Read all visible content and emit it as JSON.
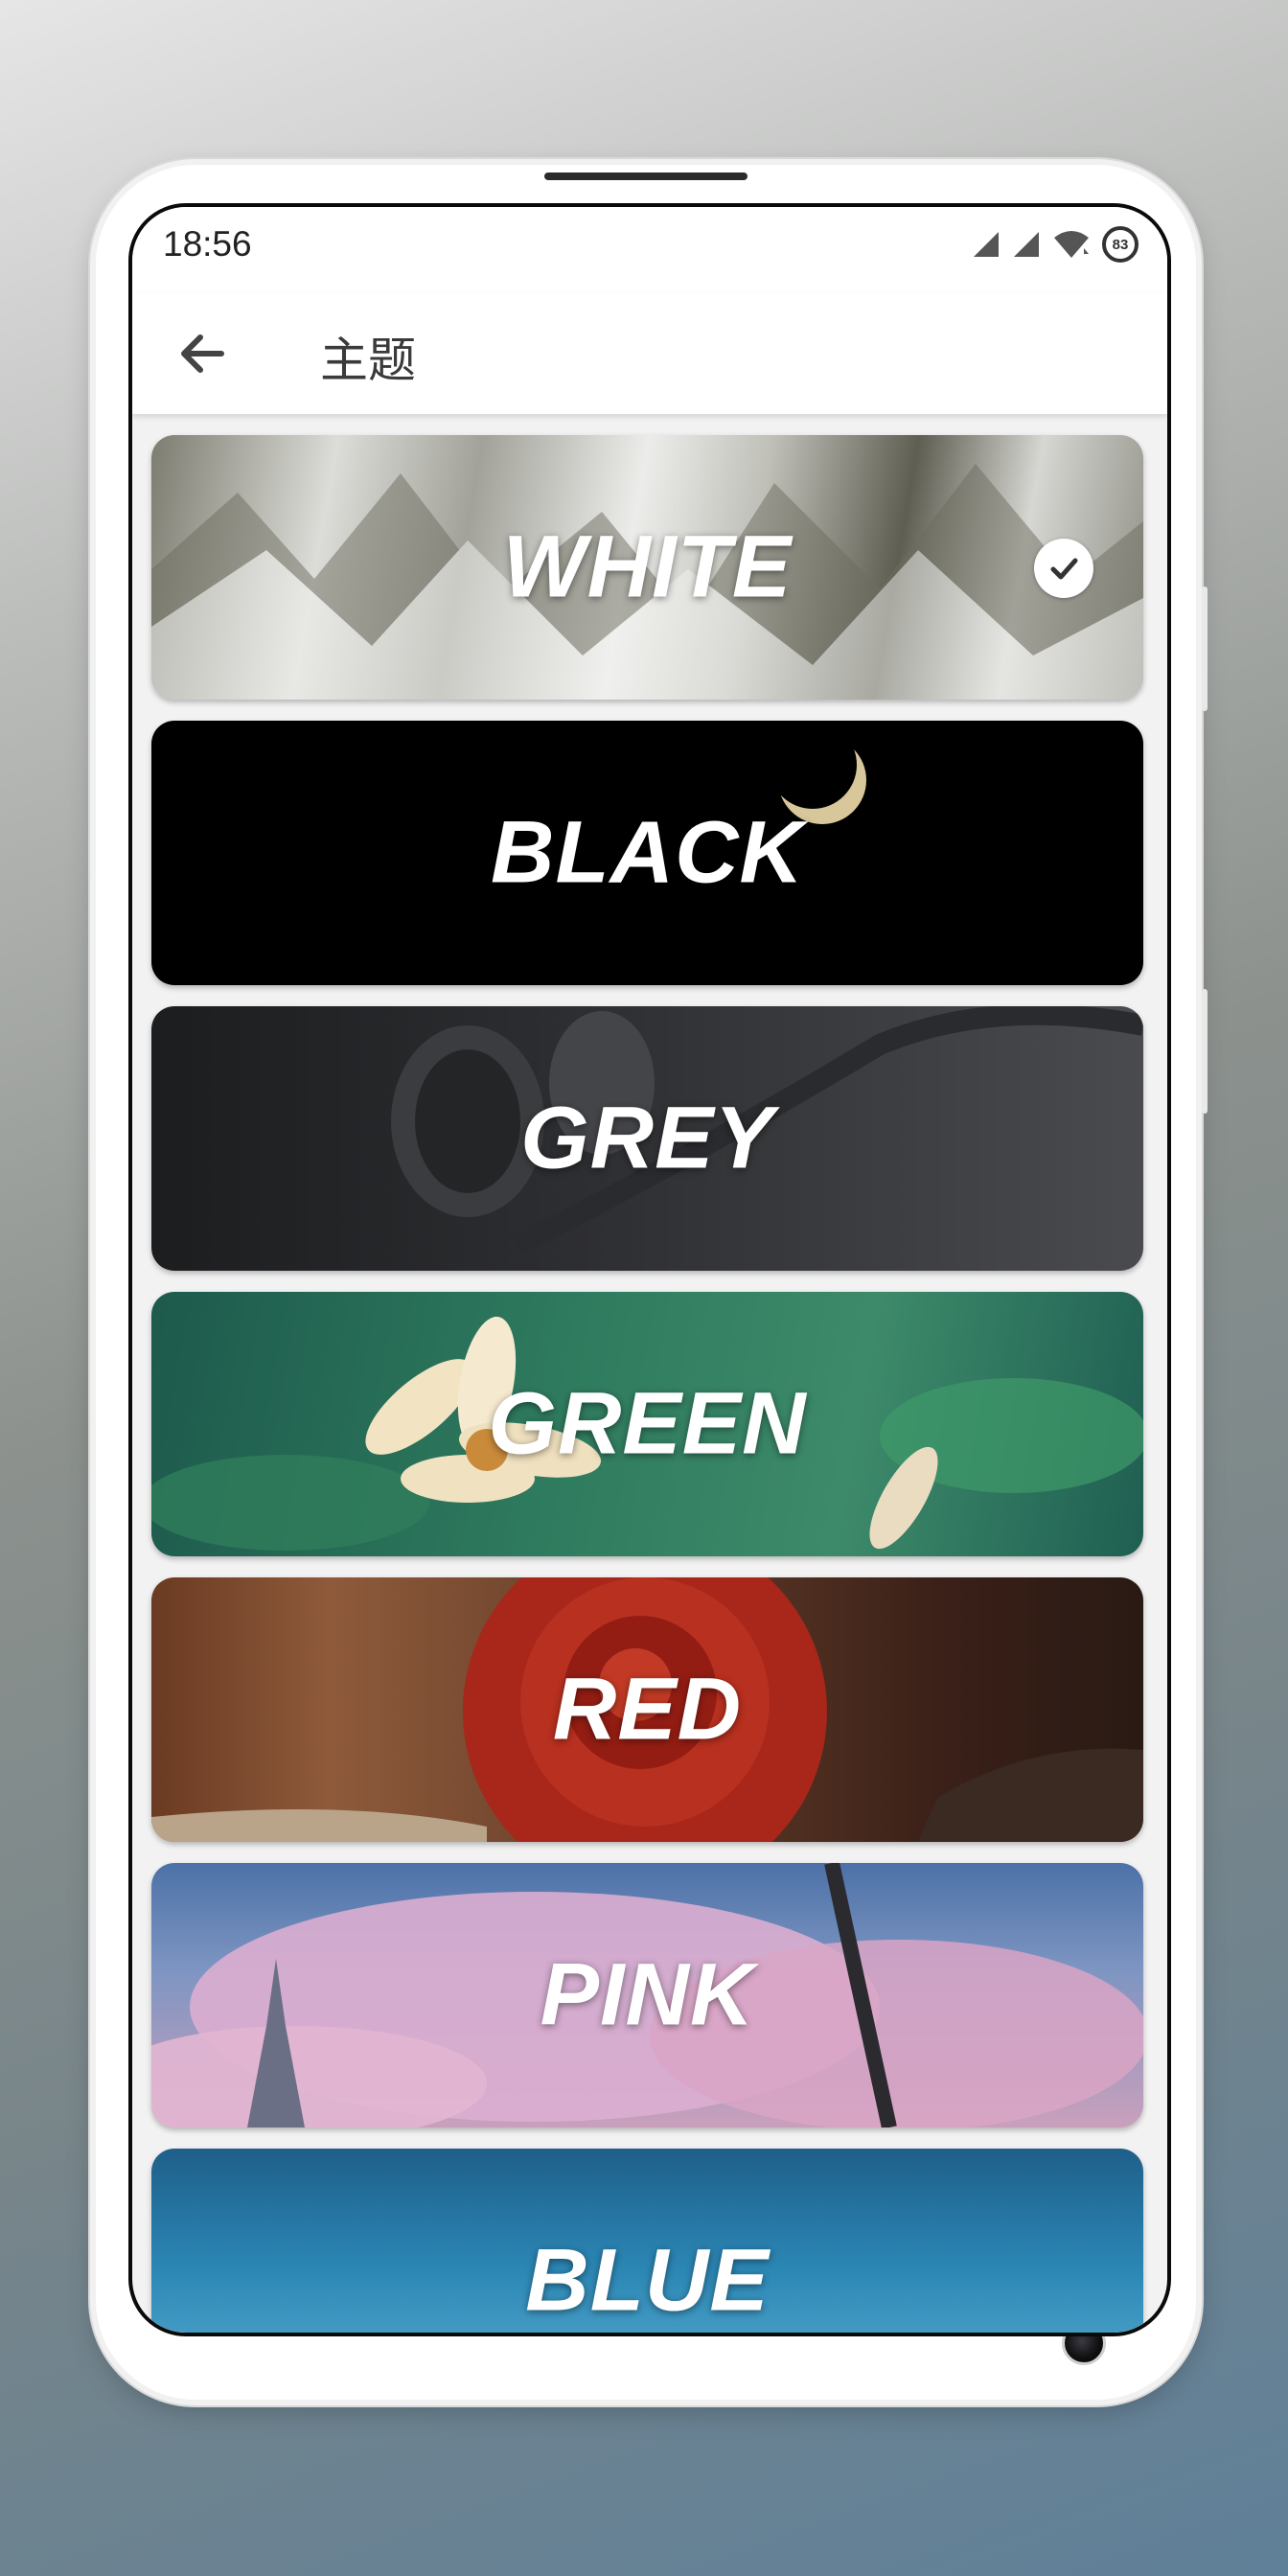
{
  "status_bar": {
    "time": "18:56",
    "battery": "83"
  },
  "app_bar": {
    "title": "主题"
  },
  "themes": [
    {
      "label": "WHITE",
      "selected": true
    },
    {
      "label": "BLACK",
      "selected": false
    },
    {
      "label": "GREY",
      "selected": false
    },
    {
      "label": "GREEN",
      "selected": false
    },
    {
      "label": "RED",
      "selected": false
    },
    {
      "label": "PINK",
      "selected": false
    },
    {
      "label": "BLUE",
      "selected": false
    }
  ],
  "icons": {
    "back": "arrow-left-icon",
    "check": "check-circle-icon",
    "signal": "signal-icon",
    "wifi": "wifi-icon",
    "battery": "battery-icon"
  },
  "colors": {
    "white_card": "#c9c9c5",
    "black_card": "#000000",
    "grey_card": "#2a2b2d",
    "green_card": "#1f6a57",
    "red_card": "#9b2014",
    "pink_card": "#c9a0bc",
    "blue_card": "#2b86b4"
  }
}
